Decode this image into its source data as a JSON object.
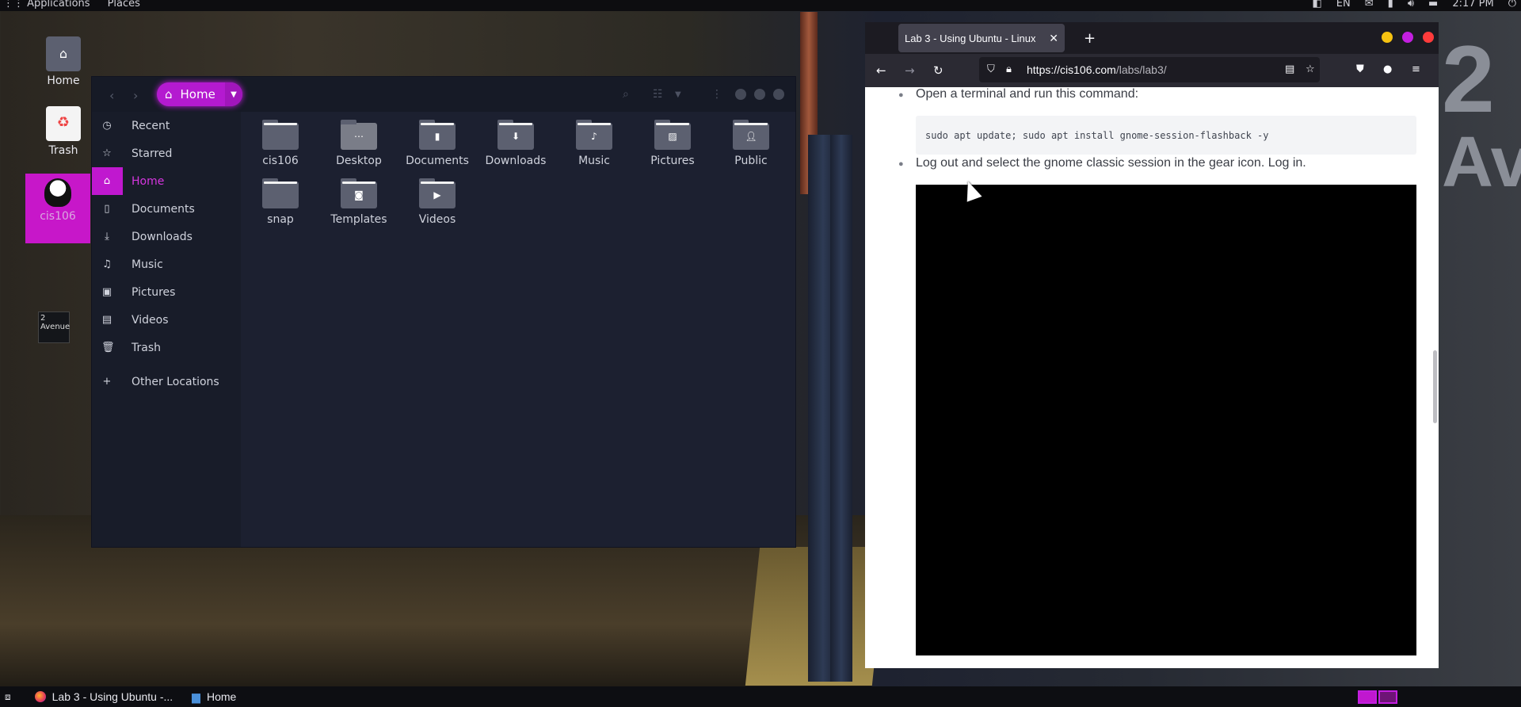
{
  "topbar": {
    "applications": "Applications",
    "places": "Places",
    "lang": "EN",
    "clock": "2:17 PM"
  },
  "desktop": {
    "icons": [
      {
        "label": "Home"
      },
      {
        "label": "Trash"
      },
      {
        "label": "cis106"
      }
    ]
  },
  "files": {
    "path_label": "Home",
    "sidebar": [
      {
        "label": "Recent",
        "icon": "clock-icon"
      },
      {
        "label": "Starred",
        "icon": "star-icon"
      },
      {
        "label": "Home",
        "icon": "home-icon",
        "active": true
      },
      {
        "label": "Documents",
        "icon": "document-icon"
      },
      {
        "label": "Downloads",
        "icon": "download-icon"
      },
      {
        "label": "Music",
        "icon": "music-icon"
      },
      {
        "label": "Pictures",
        "icon": "picture-icon"
      },
      {
        "label": "Videos",
        "icon": "video-icon"
      },
      {
        "label": "Trash",
        "icon": "trash-icon"
      },
      {
        "label": "Other Locations",
        "icon": "plus-icon"
      }
    ],
    "folders": [
      {
        "label": "cis106"
      },
      {
        "label": "Desktop"
      },
      {
        "label": "Documents"
      },
      {
        "label": "Downloads"
      },
      {
        "label": "Music"
      },
      {
        "label": "Pictures"
      },
      {
        "label": "Public"
      },
      {
        "label": "snap"
      },
      {
        "label": "Templates"
      },
      {
        "label": "Videos"
      }
    ]
  },
  "browser": {
    "tab_title": "Lab 3 - Using Ubuntu - Linux",
    "url_host": "https://cis106.com",
    "url_path": "/labs/lab3/",
    "content": {
      "step1": "Open a terminal and run this command:",
      "command": "sudo apt update; sudo apt install gnome-session-flashback -y",
      "step2": "Log out and select the gnome classic session in the gear icon. Log in."
    }
  },
  "taskbar": {
    "items": [
      {
        "label": "Lab 3 - Using Ubuntu -..."
      },
      {
        "label": "Home"
      }
    ]
  },
  "colors": {
    "accent": "#c018cf",
    "browser_dark": "#2b2a33"
  }
}
